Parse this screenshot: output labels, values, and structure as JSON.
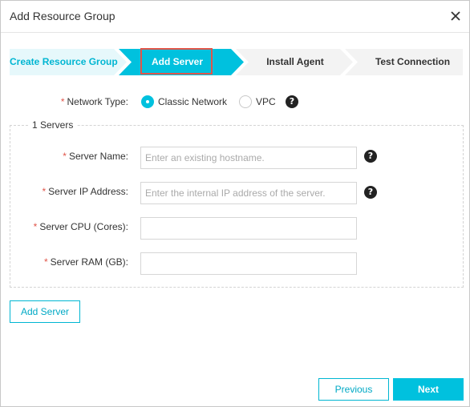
{
  "dialog": {
    "title": "Add Resource Group",
    "close_icon": "close-icon"
  },
  "steps": [
    {
      "label": "Create Resource Group",
      "state": "done"
    },
    {
      "label": "Add Server",
      "state": "active"
    },
    {
      "label": "Install Agent",
      "state": "pending"
    },
    {
      "label": "Test Connection",
      "state": "pending"
    }
  ],
  "network": {
    "label": "Network Type:",
    "options": [
      {
        "label": "Classic Network",
        "selected": true
      },
      {
        "label": "VPC",
        "selected": false
      }
    ],
    "help_icon": "question-circle-icon"
  },
  "servers": {
    "legend": "1 Servers",
    "fields": [
      {
        "label": "Server Name:",
        "value": "",
        "placeholder": "Enter an existing hostname.",
        "has_help": true
      },
      {
        "label": "Server IP Address:",
        "value": "",
        "placeholder": "Enter the internal IP address of the server.",
        "has_help": true
      },
      {
        "label": "Server CPU (Cores):",
        "value": "",
        "placeholder": "",
        "has_help": false
      },
      {
        "label": "Server RAM (GB):",
        "value": "",
        "placeholder": "",
        "has_help": false
      }
    ]
  },
  "buttons": {
    "add_server": "Add Server",
    "previous": "Previous",
    "next": "Next"
  },
  "required_mark": "*",
  "help_glyph": "?",
  "colors": {
    "accent": "#00c1de",
    "accent_light": "#e6f8fb",
    "highlight_border": "#e0554a",
    "required": "#e0554a"
  }
}
